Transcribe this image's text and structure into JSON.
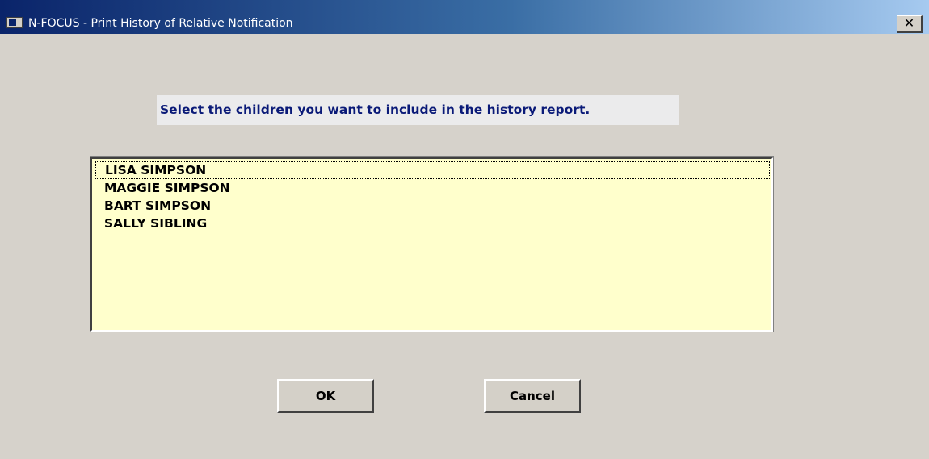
{
  "window": {
    "title": "N-FOCUS - Print History of Relative Notification",
    "close_glyph": "✕"
  },
  "instruction": "Select the children you want to include in the history report.",
  "children_list": {
    "items": [
      "LISA SIMPSON",
      "MAGGIE SIMPSON",
      "BART SIMPSON",
      "SALLY SIBLING"
    ],
    "focused_item": "LISA SIMPSON",
    "background_color": "#ffffcc"
  },
  "buttons": {
    "ok_label": "OK",
    "cancel_label": "Cancel"
  },
  "icons": {
    "app_icon": "window-app-icon",
    "close_icon": "close-icon"
  },
  "colors": {
    "title_bar_start": "#0a246a",
    "title_bar_end": "#a6caf0",
    "instruction_text": "#0a1a78",
    "dialog_background": "#d6d2cb"
  }
}
